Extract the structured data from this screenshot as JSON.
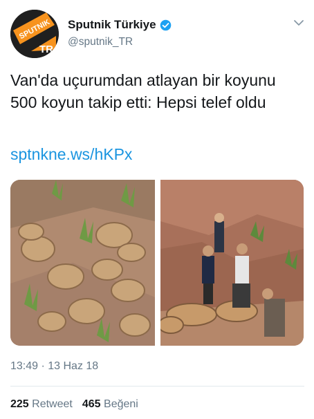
{
  "account": {
    "display_name": "Sputnik Türkiye",
    "handle": "@sputnik_TR",
    "verified": true,
    "avatar_logo_text": "SPUTNIK",
    "avatar_logo_sub": "TR"
  },
  "tweet": {
    "text": "Van'da uçurumdan atlayan bir koyunu 500 koyun takip etti: Hepsi telef oldu",
    "link": "sptnkne.ws/hKPx",
    "timestamp": "13:49 · 13 Haz 18"
  },
  "stats": {
    "retweet_count": "225",
    "retweet_label": "Retweet",
    "like_count": "465",
    "like_label": "Beğeni"
  },
  "icons": [
    "verified-badge-icon",
    "chevron-down-icon"
  ],
  "colors": {
    "link": "#1b95e0",
    "verified": "#1da1f2",
    "brand_orange": "#f7931e",
    "secondary_text": "#657786"
  }
}
